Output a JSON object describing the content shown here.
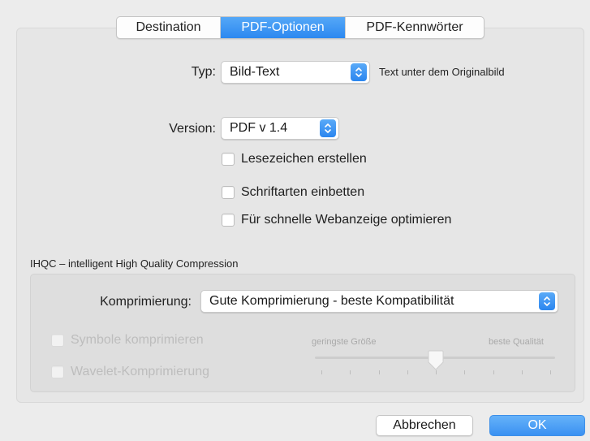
{
  "tabs": [
    {
      "label": "Destination",
      "active": false
    },
    {
      "label": "PDF-Optionen",
      "active": true
    },
    {
      "label": "PDF-Kennwörter",
      "active": false
    }
  ],
  "typ": {
    "label": "Typ:",
    "value": "Bild-Text",
    "hint": "Text unter dem Originalbild"
  },
  "version": {
    "label": "Version:",
    "value": "PDF v 1.4"
  },
  "options": [
    {
      "label": "Lesezeichen erstellen",
      "checked": false
    },
    {
      "label": "Schriftarten einbetten",
      "checked": false
    },
    {
      "label": "Für schnelle Webanzeige optimieren",
      "checked": false
    }
  ],
  "ihqc": {
    "title": "IHQC – intelligent High Quality Compression",
    "compression_label": "Komprimierung:",
    "compression_value": "Gute Komprimierung - beste Kompatibilität",
    "disabled_options": [
      {
        "label": "Symbole komprimieren",
        "checked": false,
        "enabled": false
      },
      {
        "label": "Wavelet-Komprimierung",
        "checked": false,
        "enabled": false
      }
    ],
    "slider": {
      "min_label": "geringste Größe",
      "max_label": "beste Qualität",
      "position": 0.5,
      "tick_count": 9,
      "enabled": false
    }
  },
  "buttons": {
    "cancel": "Abbrechen",
    "ok": "OK"
  },
  "colors": {
    "accent": "#2c88f0",
    "disabled_text": "#bdbdbd"
  },
  "icons": {
    "popup_stepper": "updown-chevron-icon"
  }
}
